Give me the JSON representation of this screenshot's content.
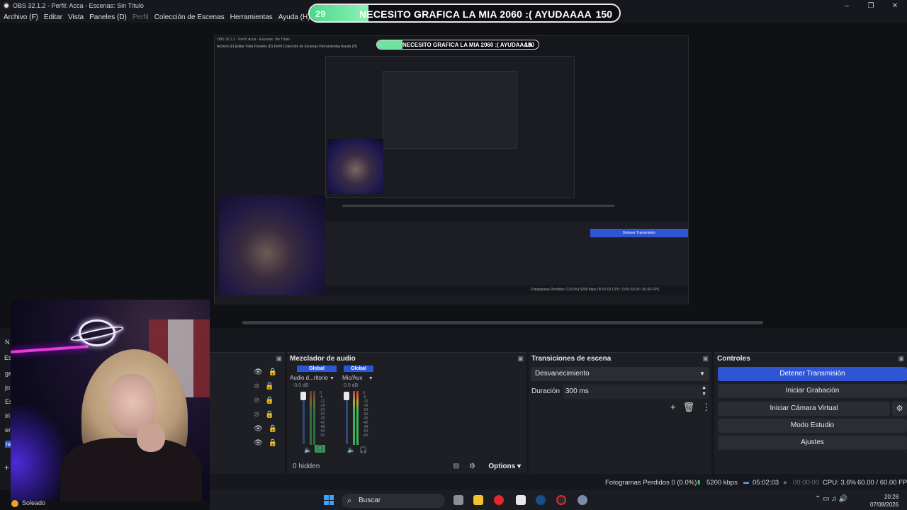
{
  "window": {
    "title": "OBS 32.1.2 - Perfil: Acca - Escenas: Sin Título",
    "controls": [
      "–",
      "❐",
      "✕"
    ]
  },
  "menu": {
    "items": [
      "Archivo (F)",
      "Editar",
      "Vista",
      "Paneles (D)",
      "Perfil",
      "Colección de Escenas",
      "Herramientas",
      "Ayuda (H)"
    ]
  },
  "banner": {
    "level": "29",
    "message": "NECESITO GRAFICA LA MIA 2060 :( AYUDAAAA",
    "count": "150",
    "progress": 0.19,
    "accent": "#49d98a"
  },
  "nested_preview": {
    "title": "OBS 32.1.2 - Perfil: Acca - Escenas: Sin Título",
    "menu": "Archivo (F)   Editar   Vista   Paneles (D)   Perfil   Colección de Escenas   Herramientas   Ayuda (H)",
    "banner_message": "NECESITO GRAFICA LA MIA 2060 :( AYUDAAAA",
    "banner_count": "150",
    "primary_control": "Detener Transmisión",
    "status": "Fotogramas Perdidos 0 (0.0%)   5200 kbps   05:02:03   CPU: 3.6%   60.00 / 60.00 FPS"
  },
  "left_dock_letters": [
    "Es",
    "N",
    "ga",
    "ju",
    "Es",
    "iri",
    "er",
    "re",
    "+"
  ],
  "mixer": {
    "title": "Mezclador de audio",
    "channels": [
      {
        "global_label": "Global",
        "name": "Audio d...ritorio",
        "db": "-0.0 dB"
      },
      {
        "global_label": "Global",
        "name": "Mic/Aux",
        "db": "0.0 dB"
      }
    ],
    "ticks": [
      "0",
      "-6",
      "-12",
      "-18",
      "-24",
      "-30",
      "-36",
      "-42",
      "-48",
      "-54",
      "-60"
    ],
    "hidden_label": "0 hidden",
    "options_label": "Options"
  },
  "transitions": {
    "title": "Transiciones de escena",
    "selected": "Desvanecimiento",
    "duration_label": "Duración",
    "duration_value": "300 ms"
  },
  "controls": {
    "title": "Controles",
    "buttons": [
      "Detener Transmisión",
      "Iniciar Grabación",
      "Iniciar Cámara Virtual",
      "Modo Estudio",
      "Ajustes"
    ],
    "primary_color": "#2f55d4"
  },
  "status": {
    "dropped": "Fotogramas Perdidos 0 (0.0%)",
    "bitrate": "5200 kbps",
    "stream_time": "05:02:03",
    "rec_time": "00:00:00",
    "cpu": "CPU: 3.6%",
    "fps": "60.00 / 60.00 FPS"
  },
  "weather": {
    "label": "Soleado"
  },
  "taskbar": {
    "search_placeholder": "Buscar",
    "time": "20:28",
    "date": "07/08/2026",
    "tray": "⌃  ▭  ♫  🔊"
  }
}
